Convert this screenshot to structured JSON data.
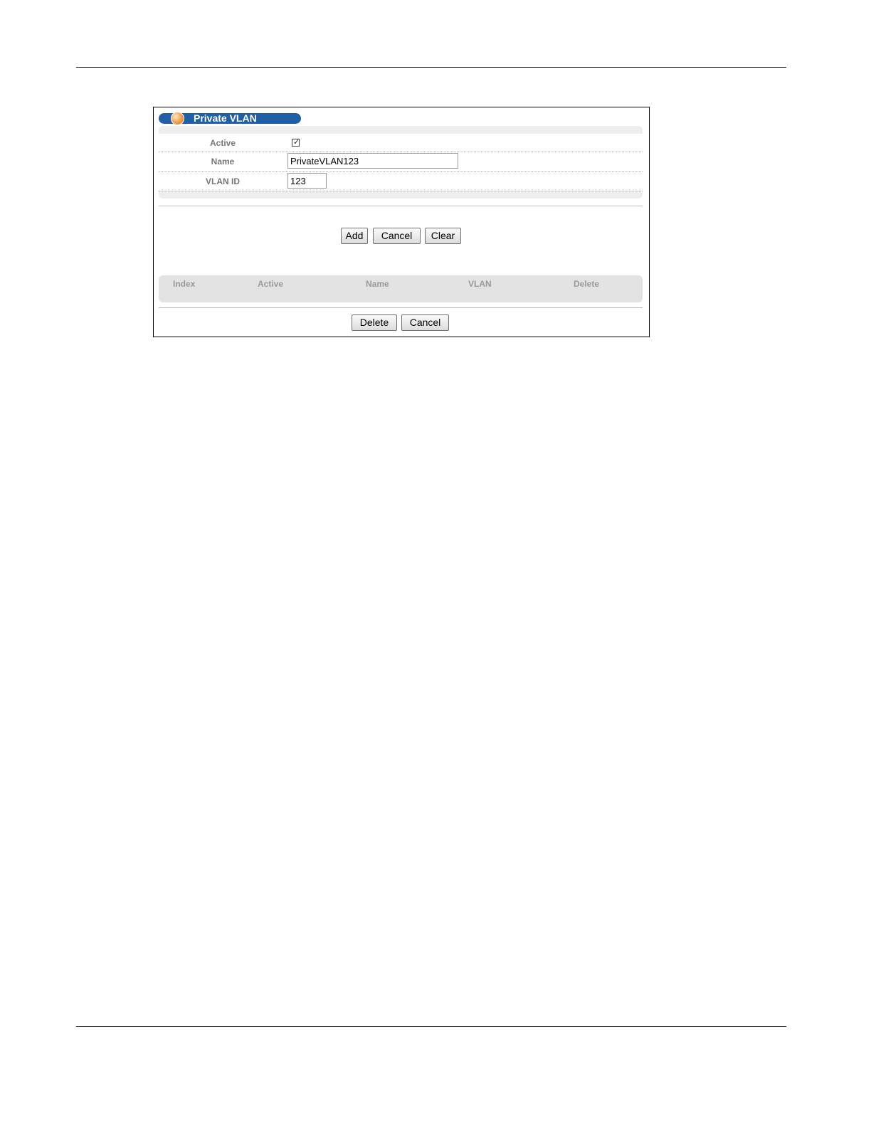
{
  "panel": {
    "title": "Private VLAN"
  },
  "form": {
    "active_label": "Active",
    "active_checked": true,
    "name_label": "Name",
    "name_value": "PrivateVLAN123",
    "vlan_id_label": "VLAN ID",
    "vlan_id_value": "123"
  },
  "actions": {
    "add_label": "Add",
    "cancel_label": "Cancel",
    "clear_label": "Clear"
  },
  "table": {
    "columns": [
      "Index",
      "Active",
      "Name",
      "VLAN",
      "Delete"
    ]
  },
  "table_actions": {
    "delete_label": "Delete",
    "cancel_label": "Cancel"
  },
  "colors": {
    "title_bar": "#1f5fa6",
    "orb": "#f6a85a",
    "panel_bg": "#eeeeee",
    "header_bg": "#e3e3e3"
  }
}
